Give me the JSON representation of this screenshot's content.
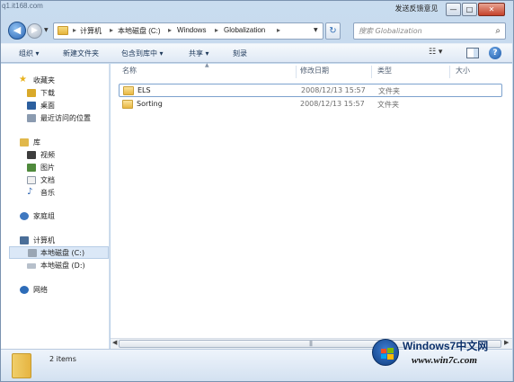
{
  "watermark_top": "q1.it168.com",
  "caption": {
    "feedback_label": "发送反馈意见",
    "min_glyph": "—",
    "max_glyph": "□",
    "close_glyph": "✕"
  },
  "nav": {
    "back_glyph": "◀",
    "forward_glyph": "▶",
    "drop_glyph": "▼",
    "refresh_glyph": "↻"
  },
  "address": {
    "crumbs": [
      "计算机",
      "本地磁盘 (C:)",
      "Windows",
      "Globalization"
    ],
    "separator": "▸"
  },
  "search": {
    "placeholder": "搜索 Globalization",
    "icon": "search-icon"
  },
  "toolbar": {
    "organize": "组织 ▾",
    "new_folder": "新建文件夹",
    "include_in_library": "包含到库中 ▾",
    "share": "共享 ▾",
    "burn": "刻录",
    "view_glyph": "☷ ▾",
    "help_glyph": "?"
  },
  "navpane": {
    "favorites": "收藏夹",
    "downloads": "下载",
    "desktop": "桌面",
    "recent": "最近访问的位置",
    "libraries": "库",
    "videos": "视频",
    "pictures": "图片",
    "documents": "文档",
    "music": "音乐",
    "homegroup": "家庭组",
    "computer": "计算机",
    "drive_c": "本地磁盘 (C:)",
    "drive_d": "本地磁盘 (D:)",
    "network": "网络"
  },
  "columns": {
    "name": "名称",
    "date": "修改日期",
    "type": "类型",
    "size": "大小"
  },
  "files": [
    {
      "name": "ELS",
      "date": "2008/12/13 15:57",
      "type": "文件夹"
    },
    {
      "name": "Sorting",
      "date": "2008/12/13 15:57",
      "type": "文件夹"
    }
  ],
  "status": {
    "count_text": "2 items"
  },
  "badge": {
    "title": "Windows7中文网",
    "url": "www.win7c.com"
  },
  "colors": {
    "frame": "#b5cde6",
    "selection": "#dbe8f7",
    "folder": "#e8b843"
  }
}
